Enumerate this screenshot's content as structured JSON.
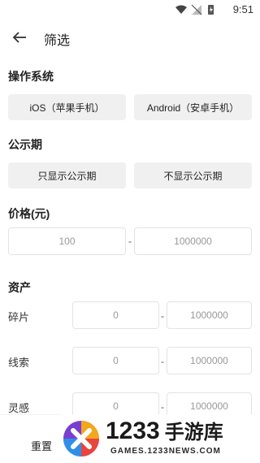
{
  "status_bar": {
    "time": "9:51"
  },
  "app_bar": {
    "title": "筛选",
    "back_icon": "arrow-left-icon"
  },
  "os_section": {
    "title": "操作系统",
    "options": [
      "iOS（苹果手机）",
      "Android（安卓手机）"
    ]
  },
  "publicity_section": {
    "title": "公示期",
    "options": [
      "只显示公示期",
      "不显示公示期"
    ]
  },
  "price_section": {
    "title": "价格(元)",
    "min_placeholder": "100",
    "max_placeholder": "1000000",
    "separator": "-"
  },
  "assets_section": {
    "title": "资产",
    "rows": [
      {
        "label": "碎片",
        "min_placeholder": "0",
        "max_placeholder": "1000000"
      },
      {
        "label": "线索",
        "min_placeholder": "0",
        "max_placeholder": "1000000"
      },
      {
        "label": "灵感",
        "min_placeholder": "0",
        "max_placeholder": "1000000"
      }
    ],
    "separator": "-"
  },
  "bottom_bar": {
    "reset_label": "重置"
  },
  "watermark": {
    "brand_number": "1233",
    "brand_cn": "手游库",
    "url": "GAMES.1233NEWS.COM"
  },
  "colors": {
    "chip_bg": "#f0f0f0",
    "input_border": "#e3e3e3",
    "placeholder": "#999999"
  }
}
